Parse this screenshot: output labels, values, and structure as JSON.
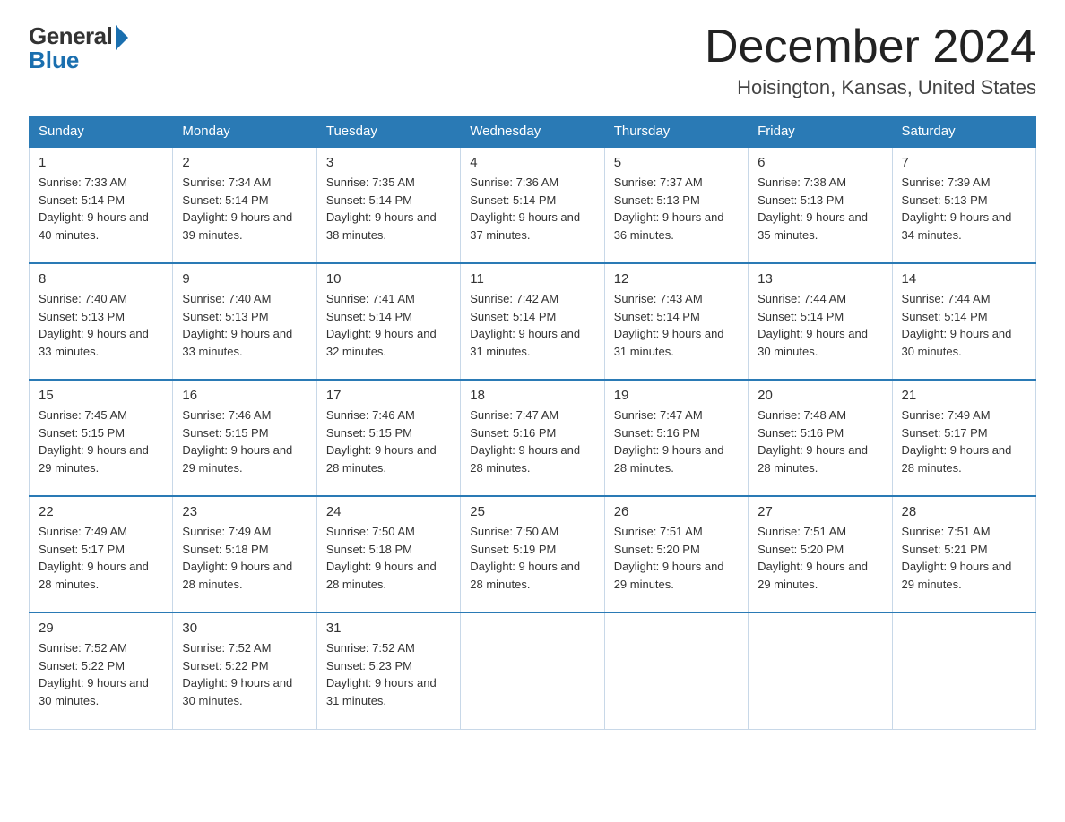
{
  "logo": {
    "general": "General",
    "blue": "Blue"
  },
  "title": {
    "month": "December 2024",
    "location": "Hoisington, Kansas, United States"
  },
  "days_of_week": [
    "Sunday",
    "Monday",
    "Tuesday",
    "Wednesday",
    "Thursday",
    "Friday",
    "Saturday"
  ],
  "weeks": [
    [
      {
        "day": "1",
        "sunrise": "7:33 AM",
        "sunset": "5:14 PM",
        "daylight": "9 hours and 40 minutes."
      },
      {
        "day": "2",
        "sunrise": "7:34 AM",
        "sunset": "5:14 PM",
        "daylight": "9 hours and 39 minutes."
      },
      {
        "day": "3",
        "sunrise": "7:35 AM",
        "sunset": "5:14 PM",
        "daylight": "9 hours and 38 minutes."
      },
      {
        "day": "4",
        "sunrise": "7:36 AM",
        "sunset": "5:14 PM",
        "daylight": "9 hours and 37 minutes."
      },
      {
        "day": "5",
        "sunrise": "7:37 AM",
        "sunset": "5:13 PM",
        "daylight": "9 hours and 36 minutes."
      },
      {
        "day": "6",
        "sunrise": "7:38 AM",
        "sunset": "5:13 PM",
        "daylight": "9 hours and 35 minutes."
      },
      {
        "day": "7",
        "sunrise": "7:39 AM",
        "sunset": "5:13 PM",
        "daylight": "9 hours and 34 minutes."
      }
    ],
    [
      {
        "day": "8",
        "sunrise": "7:40 AM",
        "sunset": "5:13 PM",
        "daylight": "9 hours and 33 minutes."
      },
      {
        "day": "9",
        "sunrise": "7:40 AM",
        "sunset": "5:13 PM",
        "daylight": "9 hours and 33 minutes."
      },
      {
        "day": "10",
        "sunrise": "7:41 AM",
        "sunset": "5:14 PM",
        "daylight": "9 hours and 32 minutes."
      },
      {
        "day": "11",
        "sunrise": "7:42 AM",
        "sunset": "5:14 PM",
        "daylight": "9 hours and 31 minutes."
      },
      {
        "day": "12",
        "sunrise": "7:43 AM",
        "sunset": "5:14 PM",
        "daylight": "9 hours and 31 minutes."
      },
      {
        "day": "13",
        "sunrise": "7:44 AM",
        "sunset": "5:14 PM",
        "daylight": "9 hours and 30 minutes."
      },
      {
        "day": "14",
        "sunrise": "7:44 AM",
        "sunset": "5:14 PM",
        "daylight": "9 hours and 30 minutes."
      }
    ],
    [
      {
        "day": "15",
        "sunrise": "7:45 AM",
        "sunset": "5:15 PM",
        "daylight": "9 hours and 29 minutes."
      },
      {
        "day": "16",
        "sunrise": "7:46 AM",
        "sunset": "5:15 PM",
        "daylight": "9 hours and 29 minutes."
      },
      {
        "day": "17",
        "sunrise": "7:46 AM",
        "sunset": "5:15 PM",
        "daylight": "9 hours and 28 minutes."
      },
      {
        "day": "18",
        "sunrise": "7:47 AM",
        "sunset": "5:16 PM",
        "daylight": "9 hours and 28 minutes."
      },
      {
        "day": "19",
        "sunrise": "7:47 AM",
        "sunset": "5:16 PM",
        "daylight": "9 hours and 28 minutes."
      },
      {
        "day": "20",
        "sunrise": "7:48 AM",
        "sunset": "5:16 PM",
        "daylight": "9 hours and 28 minutes."
      },
      {
        "day": "21",
        "sunrise": "7:49 AM",
        "sunset": "5:17 PM",
        "daylight": "9 hours and 28 minutes."
      }
    ],
    [
      {
        "day": "22",
        "sunrise": "7:49 AM",
        "sunset": "5:17 PM",
        "daylight": "9 hours and 28 minutes."
      },
      {
        "day": "23",
        "sunrise": "7:49 AM",
        "sunset": "5:18 PM",
        "daylight": "9 hours and 28 minutes."
      },
      {
        "day": "24",
        "sunrise": "7:50 AM",
        "sunset": "5:18 PM",
        "daylight": "9 hours and 28 minutes."
      },
      {
        "day": "25",
        "sunrise": "7:50 AM",
        "sunset": "5:19 PM",
        "daylight": "9 hours and 28 minutes."
      },
      {
        "day": "26",
        "sunrise": "7:51 AM",
        "sunset": "5:20 PM",
        "daylight": "9 hours and 29 minutes."
      },
      {
        "day": "27",
        "sunrise": "7:51 AM",
        "sunset": "5:20 PM",
        "daylight": "9 hours and 29 minutes."
      },
      {
        "day": "28",
        "sunrise": "7:51 AM",
        "sunset": "5:21 PM",
        "daylight": "9 hours and 29 minutes."
      }
    ],
    [
      {
        "day": "29",
        "sunrise": "7:52 AM",
        "sunset": "5:22 PM",
        "daylight": "9 hours and 30 minutes."
      },
      {
        "day": "30",
        "sunrise": "7:52 AM",
        "sunset": "5:22 PM",
        "daylight": "9 hours and 30 minutes."
      },
      {
        "day": "31",
        "sunrise": "7:52 AM",
        "sunset": "5:23 PM",
        "daylight": "9 hours and 31 minutes."
      },
      null,
      null,
      null,
      null
    ]
  ]
}
